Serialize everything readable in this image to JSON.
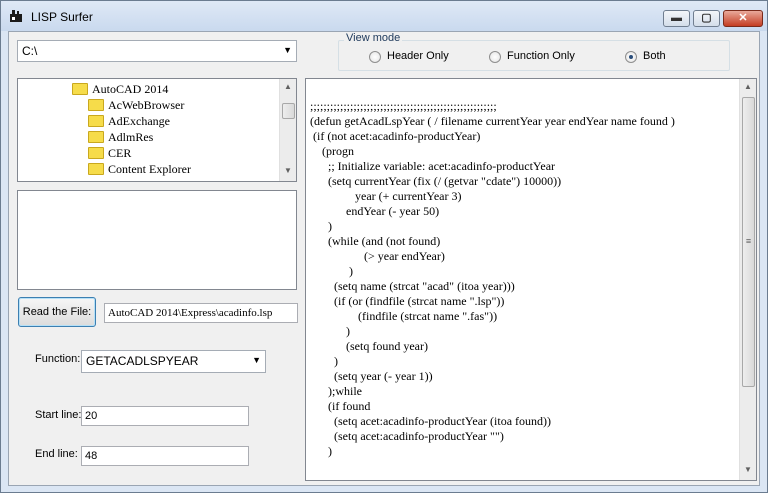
{
  "window": {
    "title": "LISP Surfer",
    "min_label": "▬",
    "max_label": "▢",
    "close_label": "✕"
  },
  "path_combo": {
    "value": "C:\\"
  },
  "view_mode": {
    "legend": "View mode",
    "options": [
      {
        "label": "Header Only",
        "checked": false
      },
      {
        "label": "Function Only",
        "checked": false
      },
      {
        "label": "Both",
        "checked": true
      }
    ]
  },
  "tree": {
    "items": [
      {
        "label": "AutoCAD 2014"
      },
      {
        "label": "AcWebBrowser"
      },
      {
        "label": "AdExchange"
      },
      {
        "label": "AdlmRes"
      },
      {
        "label": "CER"
      },
      {
        "label": "Content Explorer"
      }
    ]
  },
  "read_file": {
    "button_label": "Read the File:",
    "path_value": "AutoCAD 2014\\Express\\acadinfo.lsp"
  },
  "function": {
    "label": "Function:",
    "value": "GETACADLSPYEAR"
  },
  "start_line": {
    "label": "Start line:",
    "value": "20"
  },
  "end_line": {
    "label": "End line:",
    "value": "48"
  },
  "code": {
    "lines": [
      ";;;;;;;;;;;;;;;;;;;;;;;;;;;;;;;;;;;;;;;;;;;;;;;;;;;;;;;;",
      "(defun getAcadLspYear ( / filename currentYear year endYear name found )",
      " (if (not acet:acadinfo-productYear)",
      "    (progn",
      "      ;; Initialize variable: acet:acadinfo-productYear",
      "      (setq currentYear (fix (/ (getvar \"cdate\") 10000))",
      "               year (+ currentYear 3)",
      "            endYear (- year 50)",
      "      )",
      "      (while (and (not found)",
      "                  (> year endYear)",
      "             )",
      "        (setq name (strcat \"acad\" (itoa year)))",
      "        (if (or (findfile (strcat name \".lsp\"))",
      "                (findfile (strcat name \".fas\"))",
      "            )",
      "            (setq found year)",
      "        )",
      "        (setq year (- year 1))",
      "      );while",
      "      (if found",
      "        (setq acet:acadinfo-productYear (itoa found))",
      "        (setq acet:acadinfo-productYear \"\")",
      "      )"
    ]
  },
  "scroll_arrows": {
    "up": "▲",
    "down": "▼",
    "grip": "≡"
  }
}
